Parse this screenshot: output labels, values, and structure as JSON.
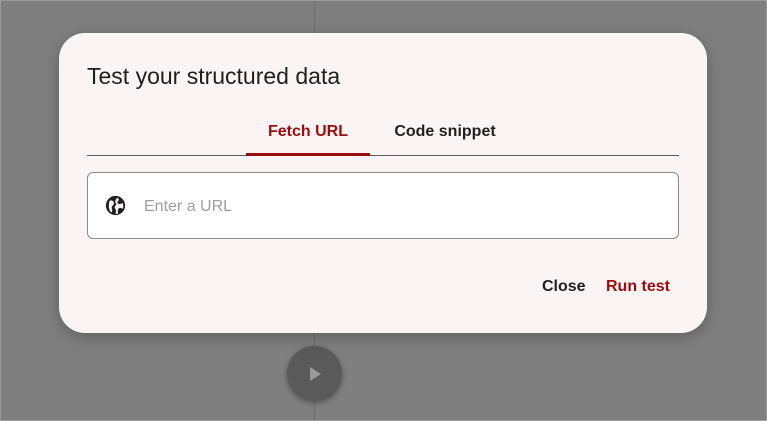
{
  "dialog": {
    "title": "Test your structured data",
    "tabs": [
      {
        "label": "Fetch URL",
        "active": true
      },
      {
        "label": "Code snippet",
        "active": false
      }
    ],
    "url_input": {
      "value": "",
      "placeholder": "Enter a URL",
      "icon": "globe-icon"
    },
    "actions": {
      "close_label": "Close",
      "run_label": "Run test"
    }
  },
  "background": {
    "play_icon": "play-icon"
  },
  "colors": {
    "accent": "#9c0c0c",
    "dialog_bg": "#faf5f4",
    "overlay": "#7f7f7f",
    "text": "#1f1f1f"
  }
}
